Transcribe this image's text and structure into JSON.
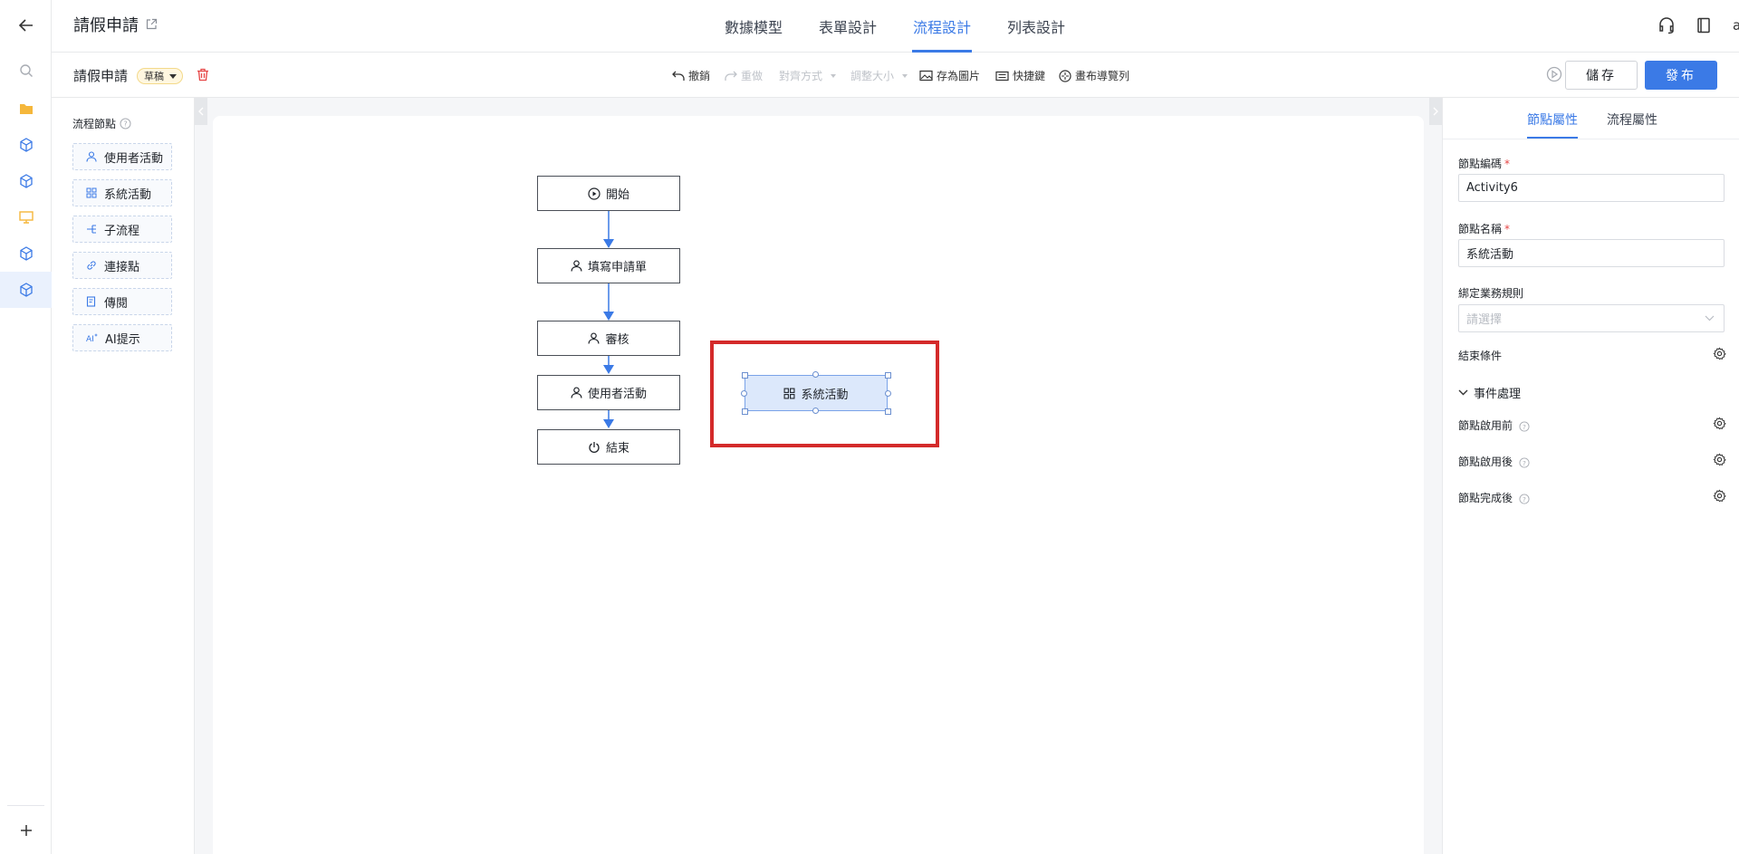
{
  "app": {
    "title": "請假申請",
    "tabs": [
      {
        "label": "數據模型"
      },
      {
        "label": "表單設計"
      },
      {
        "label": "流程設計"
      },
      {
        "label": "列表設計"
      }
    ],
    "user": "ana"
  },
  "toolbar": {
    "flow_title": "請假申請",
    "badge": "草稿",
    "undo": "撤銷",
    "redo": "重做",
    "align": "對齊方式",
    "resize": "調整大小",
    "save_image": "存為圖片",
    "shortcuts": "快捷鍵",
    "canvas_nav": "畫布導覽列",
    "save": "儲存",
    "publish": "發布"
  },
  "palette": {
    "title": "流程節點",
    "items": [
      {
        "label": "使用者活動",
        "icon": "user-icon"
      },
      {
        "label": "系統活動",
        "icon": "grid-icon"
      },
      {
        "label": "子流程",
        "icon": "subflow-icon"
      },
      {
        "label": "連接點",
        "icon": "link-icon"
      },
      {
        "label": "傳閱",
        "icon": "circulate-icon"
      },
      {
        "label": "AI提示",
        "icon": "ai-icon"
      }
    ]
  },
  "flow": {
    "nodes": [
      {
        "label": "開始",
        "icon": "play-icon"
      },
      {
        "label": "填寫申請單",
        "icon": "user-icon"
      },
      {
        "label": "審核",
        "icon": "user-icon"
      },
      {
        "label": "使用者活動",
        "icon": "user-icon"
      },
      {
        "label": "結束",
        "icon": "power-icon"
      }
    ],
    "selected_node": {
      "label": "系統活動",
      "icon": "grid-icon"
    }
  },
  "panel": {
    "tabs": [
      {
        "label": "節點屬性"
      },
      {
        "label": "流程屬性"
      }
    ],
    "node_code_label": "節點編碼",
    "node_code_value": "Activity6",
    "node_name_label": "節點名稱",
    "node_name_value": "系統活動",
    "business_rule_label": "綁定業務規則",
    "business_rule_placeholder": "請選擇",
    "end_condition_label": "結束條件",
    "event_title": "事件處理",
    "events": [
      {
        "label": "節點啟用前"
      },
      {
        "label": "節點啟用後"
      },
      {
        "label": "節點完成後"
      }
    ]
  },
  "colors": {
    "accent": "#3b7ae6",
    "highlight": "#d42a2a",
    "draft": "#fff7e0"
  }
}
